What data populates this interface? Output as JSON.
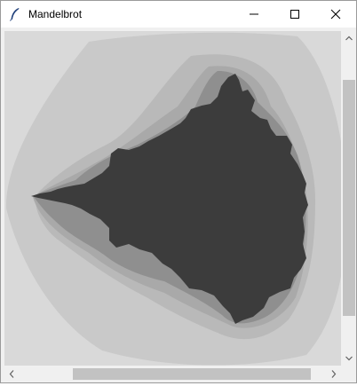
{
  "window": {
    "title": "Mandelbrot",
    "app_icon": "feather-icon",
    "controls": {
      "minimize_icon": "minimize-icon",
      "maximize_icon": "maximize-icon",
      "close_icon": "close-icon"
    }
  },
  "canvas": {
    "content": "mandelbrot-set-render",
    "colors": {
      "background": "#d9d9d9",
      "band1": "#c9c9c9",
      "band2": "#b9b9b9",
      "band3": "#a9a9a9",
      "band4": "#8f8f8f",
      "interior": "#3c3c3c"
    }
  },
  "scrollbars": {
    "vertical": {
      "up_icon": "chevron-up-icon",
      "down_icon": "chevron-down-icon"
    },
    "horizontal": {
      "left_icon": "chevron-left-icon",
      "right_icon": "chevron-right-icon"
    }
  }
}
